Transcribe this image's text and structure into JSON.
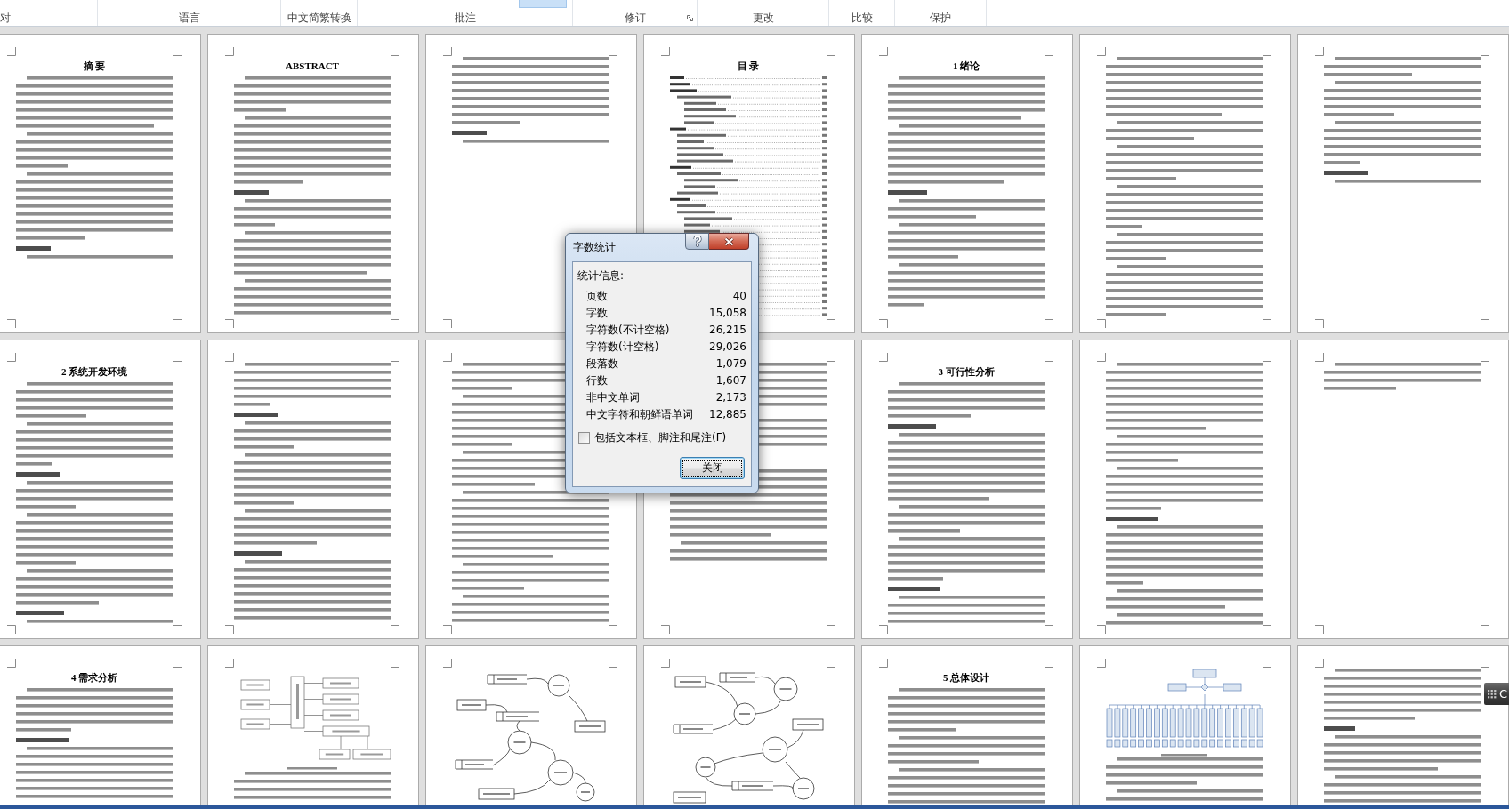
{
  "ribbon": {
    "groups": [
      {
        "label": "对",
        "launcher": false
      },
      {
        "label": "语言",
        "launcher": false
      },
      {
        "label": "中文简繁转换",
        "launcher": false
      },
      {
        "label": "批注",
        "launcher": false,
        "buttons": [
          {
            "selected": true
          }
        ]
      },
      {
        "label": "修订",
        "launcher": true
      },
      {
        "label": "更改",
        "launcher": false
      },
      {
        "label": "比较",
        "launcher": false
      },
      {
        "label": "保护",
        "launcher": false
      }
    ]
  },
  "pages": [
    {
      "kind": "long",
      "title": "摘 要"
    },
    {
      "kind": "full",
      "title": "ABSTRACT"
    },
    {
      "kind": "short"
    },
    {
      "kind": "toc",
      "title": "目 录"
    },
    {
      "kind": "full",
      "title": "1 绪论"
    },
    {
      "kind": "full"
    },
    {
      "kind": "half"
    },
    {
      "kind": "full",
      "title": "2 系统开发环境"
    },
    {
      "kind": "full"
    },
    {
      "kind": "full"
    },
    {
      "kind": "long"
    },
    {
      "kind": "full",
      "title": "3 可行性分析"
    },
    {
      "kind": "full"
    },
    {
      "kind": "brief"
    },
    {
      "kind": "full",
      "title": "4 需求分析"
    },
    {
      "kind": "flowchart"
    },
    {
      "kind": "dataflow"
    },
    {
      "kind": "dataflow"
    },
    {
      "kind": "full",
      "title": "5 总体设计"
    },
    {
      "kind": "tree"
    },
    {
      "kind": "full"
    }
  ],
  "dialog": {
    "title": "字数统计",
    "section": "统计信息:",
    "stats": [
      {
        "label": "页数",
        "value": "40"
      },
      {
        "label": "字数",
        "value": "15,058"
      },
      {
        "label": "字符数(不计空格)",
        "value": "26,215"
      },
      {
        "label": "字符数(计空格)",
        "value": "29,026"
      },
      {
        "label": "段落数",
        "value": "1,079"
      },
      {
        "label": "行数",
        "value": "1,607"
      },
      {
        "label": "非中文单词",
        "value": "2,173"
      },
      {
        "label": "中文字符和朝鲜语单词",
        "value": "12,885"
      }
    ],
    "include_option": {
      "label": "包括文本框、脚注和尾注(F)",
      "checked": false
    },
    "close_button": "关闭"
  },
  "side_tab": {
    "label": "C"
  }
}
